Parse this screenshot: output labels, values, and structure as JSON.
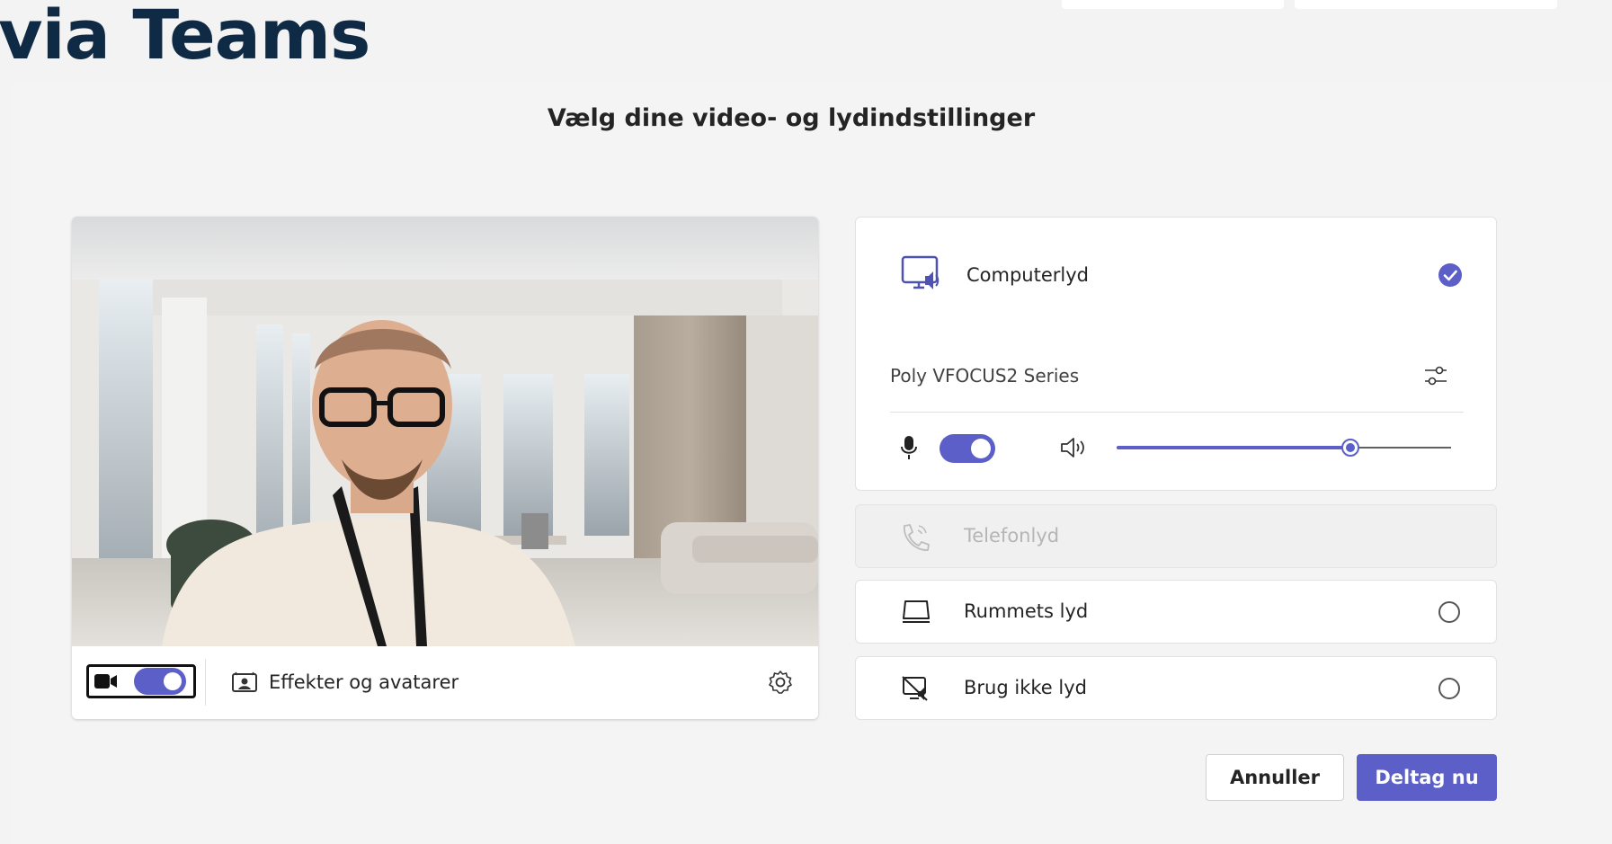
{
  "page": {
    "heading": "via Teams",
    "subtitle": "Vælg dine video- og lydindstillinger"
  },
  "video": {
    "camera_toggle_state": "on",
    "effects_label": "Effekter og avatarer"
  },
  "audio": {
    "options": [
      {
        "label": "Computerlyd",
        "state": "selected"
      },
      {
        "label": "Telefonlyd",
        "state": "disabled"
      },
      {
        "label": "Rummets lyd",
        "state": "unselected"
      },
      {
        "label": "Brug ikke lyd",
        "state": "unselected"
      }
    ],
    "device_name": "Poly VFOCUS2 Series",
    "mic_toggle_state": "on",
    "volume_level": 0.7
  },
  "actions": {
    "cancel_label": "Annuller",
    "join_label": "Deltag nu"
  },
  "colors": {
    "accent": "#5b5fc7",
    "heading": "#0f2a45",
    "background": "#f3f3f3"
  },
  "icons": {
    "camera": "video-camera-icon",
    "effects": "effects-avatar-icon",
    "settings": "gear-icon",
    "computer_audio": "monitor-speaker-icon",
    "device_settings": "sliders-icon",
    "microphone": "microphone-icon",
    "speaker": "speaker-icon",
    "phone": "phone-icon",
    "room": "room-device-icon",
    "no_audio": "no-audio-icon",
    "selected": "checkmark-circle-icon"
  }
}
